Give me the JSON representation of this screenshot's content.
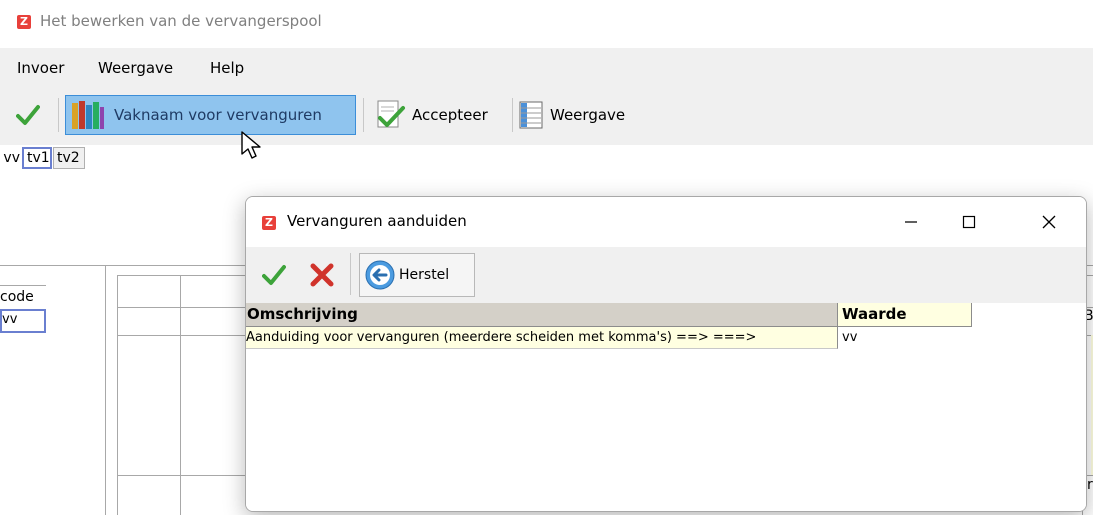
{
  "window": {
    "title": "Het bewerken van de vervangerspool"
  },
  "menu": [
    "Invoer",
    "Weergave",
    "Help"
  ],
  "toolbar": {
    "vaknaam_label": "Vaknaam voor vervanguren",
    "accepteer_label": "Accepteer",
    "weergave_label": "Weergave"
  },
  "tabs": [
    "vv",
    "tv1",
    "tv2"
  ],
  "background_grid": {
    "code_header": "code",
    "code_value": "vv",
    "right_clipped_text": "B",
    "bottom_right_text": "r"
  },
  "dialog": {
    "title": "Vervanguren aanduiden",
    "herstel_label": "Herstel",
    "columns": [
      "Omschrijving",
      "Waarde"
    ],
    "rows": [
      {
        "omschrijving": "Aanduiding voor vervanguren (meerdere scheiden met komma's) ==>  ===>",
        "waarde": "vv"
      }
    ]
  },
  "colors": {
    "accent_highlight": "#8fc4ee",
    "header_gray": "#d4d0c8",
    "cell_yellow": "#ffffe1",
    "app_icon_red": "#e8403a"
  }
}
